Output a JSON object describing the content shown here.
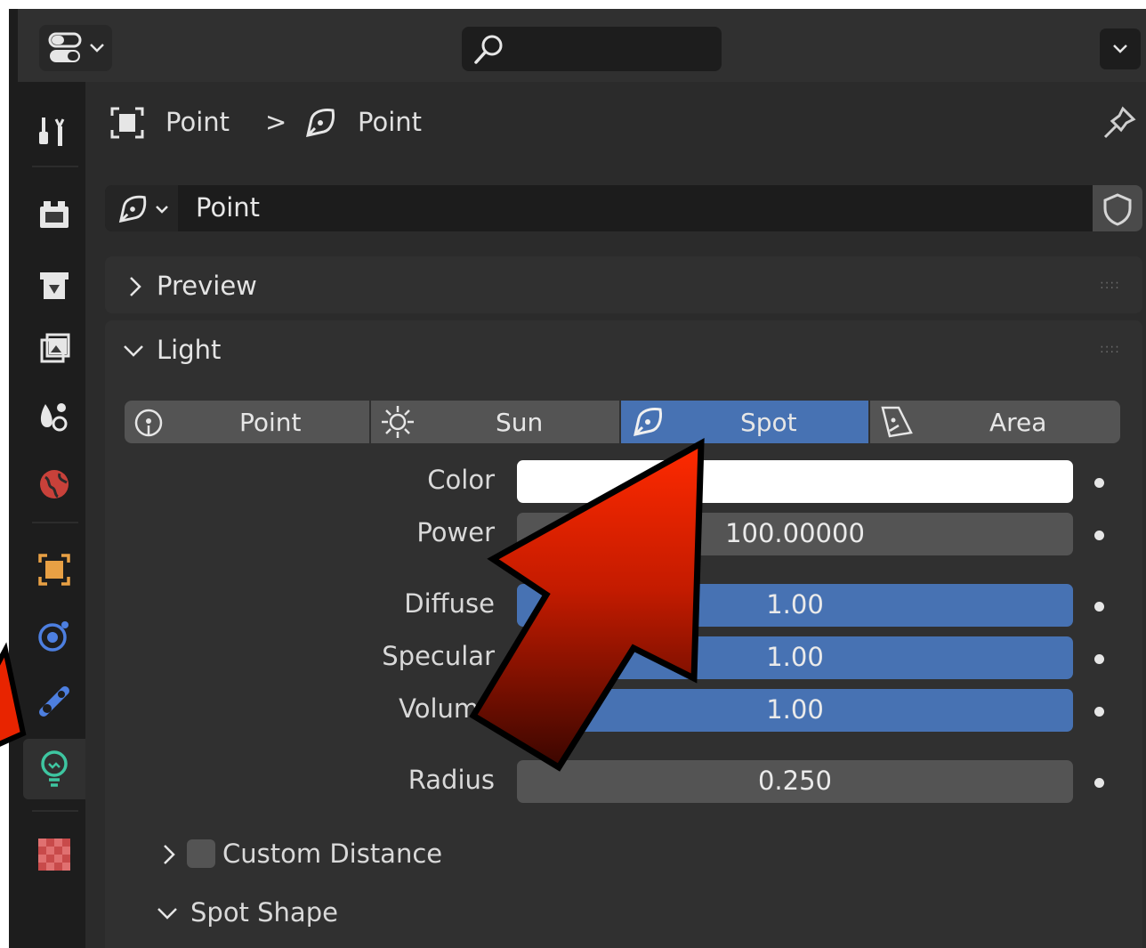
{
  "header": {
    "editor_type_icon": "properties-editor-icon",
    "search_placeholder": "",
    "menu_icon": "chevron-down-icon"
  },
  "tabs": [
    {
      "id": "tool",
      "icon": "tool-icon"
    },
    {
      "id": "render",
      "icon": "render-icon"
    },
    {
      "id": "output",
      "icon": "output-icon"
    },
    {
      "id": "view-layer",
      "icon": "view-layer-icon"
    },
    {
      "id": "scene",
      "icon": "scene-icon"
    },
    {
      "id": "world",
      "icon": "world-icon"
    },
    {
      "id": "object",
      "icon": "object-icon"
    },
    {
      "id": "physics",
      "icon": "physics-icon"
    },
    {
      "id": "constraints",
      "icon": "constraints-icon"
    },
    {
      "id": "light-data",
      "icon": "light-bulb-icon",
      "active": true
    },
    {
      "id": "texture",
      "icon": "texture-icon"
    }
  ],
  "breadcrumb": {
    "object_name": "Point",
    "separator": ">",
    "data_name": "Point"
  },
  "datablock": {
    "name": "Point"
  },
  "panels": {
    "preview": {
      "title": "Preview",
      "collapsed": true
    },
    "light": {
      "title": "Light",
      "collapsed": false
    }
  },
  "light_types": [
    {
      "label": "Point",
      "icon": "point-light-icon",
      "selected": false
    },
    {
      "label": "Sun",
      "icon": "sun-light-icon",
      "selected": false
    },
    {
      "label": "Spot",
      "icon": "spot-light-icon",
      "selected": true
    },
    {
      "label": "Area",
      "icon": "area-light-icon",
      "selected": false
    }
  ],
  "properties": {
    "color": {
      "label": "Color",
      "value": "#ffffff"
    },
    "power": {
      "label": "Power",
      "value": "100.00000"
    },
    "diffuse": {
      "label": "Diffuse",
      "value": "1.00"
    },
    "specular": {
      "label": "Specular",
      "value": "1.00"
    },
    "volume": {
      "label": "Volume",
      "value": "1.00"
    },
    "radius": {
      "label": "Radius",
      "value": "0.250"
    }
  },
  "subpanels": {
    "custom_distance": {
      "label": "Custom Distance",
      "checked": false
    },
    "spot_shape": {
      "label": "Spot Shape"
    }
  },
  "colors": {
    "accent_blue": "#4772b3",
    "active_tab_green": "#3ec6a1",
    "annotation_arrow_red": "#e82400"
  }
}
